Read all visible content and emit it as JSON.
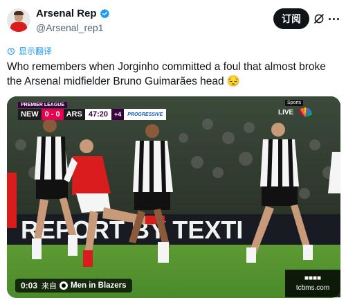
{
  "author": {
    "name": "Arsenal Rep",
    "handle": "@Arsenal_rep1"
  },
  "actions": {
    "subscribe_label": "订阅"
  },
  "translate": {
    "label": "显示翻译"
  },
  "tweet": {
    "text": "Who remembers when Jorginho committed a foul that almost broke the Arsenal midfielder Bruno Guimarães head 😔"
  },
  "video": {
    "scorebug": {
      "league": "PREMIER LEAGUE",
      "home": "NEW",
      "home_score": "0",
      "separator": "-",
      "away_score": "0",
      "away": "ARS",
      "clock": "47:20",
      "added": "+4",
      "tag": "PROGRESSIVE"
    },
    "broadcaster": {
      "live": "LIVE",
      "network": "Sports"
    },
    "banner_text": "REPORT BY TEXTI",
    "elapsed": "0:03",
    "from_label": "来自",
    "source": "Men in Blazers"
  },
  "watermark": {
    "line1": "■■■■",
    "line2": "tcbms.com"
  },
  "colors": {
    "link_blue": "#1d9bf0",
    "verified_blue": "#1d9bf0",
    "arsenal_red": "#d91d1d"
  }
}
